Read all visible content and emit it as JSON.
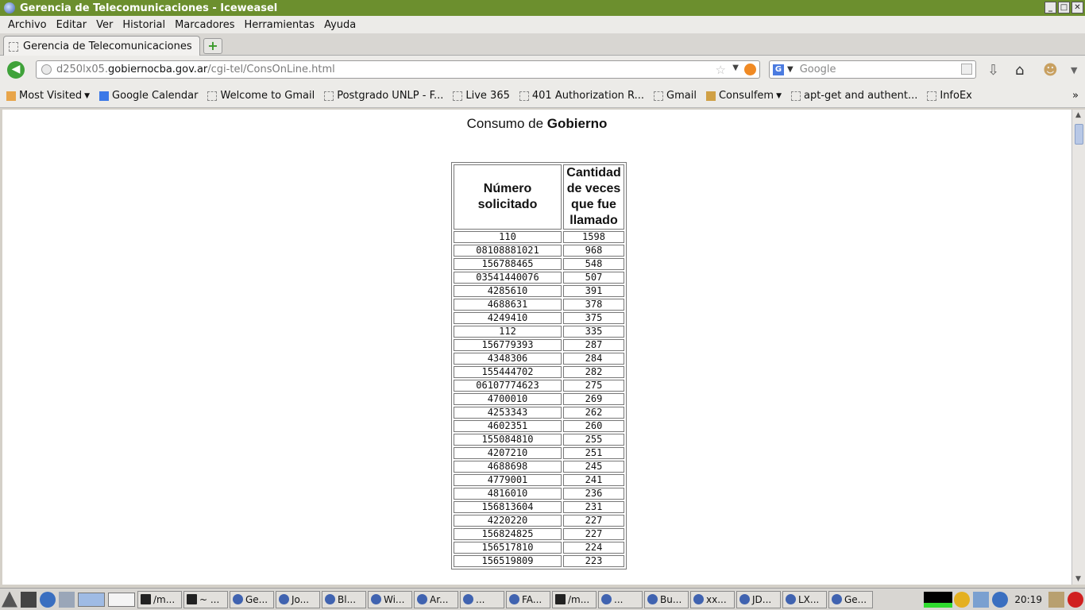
{
  "window": {
    "title": "Gerencia de Telecomunicaciones - Iceweasel",
    "min": "_",
    "max": "□",
    "close": "✕"
  },
  "menu": [
    "Archivo",
    "Editar",
    "Ver",
    "Historial",
    "Marcadores",
    "Herramientas",
    "Ayuda"
  ],
  "tab": {
    "label": "Gerencia de Telecomunicaciones",
    "new_tab": "+"
  },
  "nav": {
    "url_prefix": "d250lx05.",
    "url_domain": "gobiernocba.gov.ar",
    "url_path": "/cgi-tel/ConsOnLine.html",
    "search_placeholder": "Google",
    "search_engine_letter": "G"
  },
  "bookmarks": [
    {
      "label": "Most Visited",
      "icon": "folder-icon"
    },
    {
      "label": "Google Calendar",
      "icon": "calendar-icon"
    },
    {
      "label": "Welcome to Gmail",
      "icon": "page-icon"
    },
    {
      "label": "Postgrado UNLP - F...",
      "icon": "page-icon"
    },
    {
      "label": "Live 365",
      "icon": "page-icon"
    },
    {
      "label": "401 Authorization R...",
      "icon": "page-icon"
    },
    {
      "label": "Gmail",
      "icon": "page-icon"
    },
    {
      "label": "Consulfem",
      "icon": "folder-icon"
    },
    {
      "label": "apt-get and authent...",
      "icon": "page-icon"
    },
    {
      "label": "InfoEx",
      "icon": "page-icon"
    }
  ],
  "page": {
    "heading_prefix": "Consumo de",
    "heading_bold": "Gobierno",
    "col1": "Número solicitado",
    "col2": "Cantidad de veces que fue llamado",
    "rows": [
      [
        "110",
        "1598"
      ],
      [
        "08108881021",
        "968"
      ],
      [
        "156788465",
        "548"
      ],
      [
        "03541440076",
        "507"
      ],
      [
        "4285610",
        "391"
      ],
      [
        "4688631",
        "378"
      ],
      [
        "4249410",
        "375"
      ],
      [
        "112",
        "335"
      ],
      [
        "156779393",
        "287"
      ],
      [
        "4348306",
        "284"
      ],
      [
        "155444702",
        "282"
      ],
      [
        "06107774623",
        "275"
      ],
      [
        "4700010",
        "269"
      ],
      [
        "4253343",
        "262"
      ],
      [
        "4602351",
        "260"
      ],
      [
        "155084810",
        "255"
      ],
      [
        "4207210",
        "251"
      ],
      [
        "4688698",
        "245"
      ],
      [
        "4779001",
        "241"
      ],
      [
        "4816010",
        "236"
      ],
      [
        "156813604",
        "231"
      ],
      [
        "4220220",
        "227"
      ],
      [
        "156824825",
        "227"
      ],
      [
        "156517810",
        "224"
      ],
      [
        "156519809",
        "223"
      ]
    ]
  },
  "taskbar": {
    "tasks": [
      {
        "label": "/m...",
        "icon": "terminal"
      },
      {
        "label": "~ ...",
        "icon": "terminal"
      },
      {
        "label": "Ge...",
        "icon": "browser"
      },
      {
        "label": "Jo...",
        "icon": "browser"
      },
      {
        "label": "Bl...",
        "icon": "browser"
      },
      {
        "label": "Wi...",
        "icon": "browser"
      },
      {
        "label": "Ar...",
        "icon": "browser"
      },
      {
        "label": "...",
        "icon": "browser"
      },
      {
        "label": "FA...",
        "icon": "browser"
      },
      {
        "label": "/m...",
        "icon": "terminal"
      },
      {
        "label": "...",
        "icon": "app"
      },
      {
        "label": "Bu...",
        "icon": "search"
      },
      {
        "label": "xx...",
        "icon": "app"
      },
      {
        "label": "JD...",
        "icon": "app"
      },
      {
        "label": "LX...",
        "icon": "app"
      },
      {
        "label": "Ge...",
        "icon": "browser"
      }
    ],
    "clock": "20:19"
  }
}
